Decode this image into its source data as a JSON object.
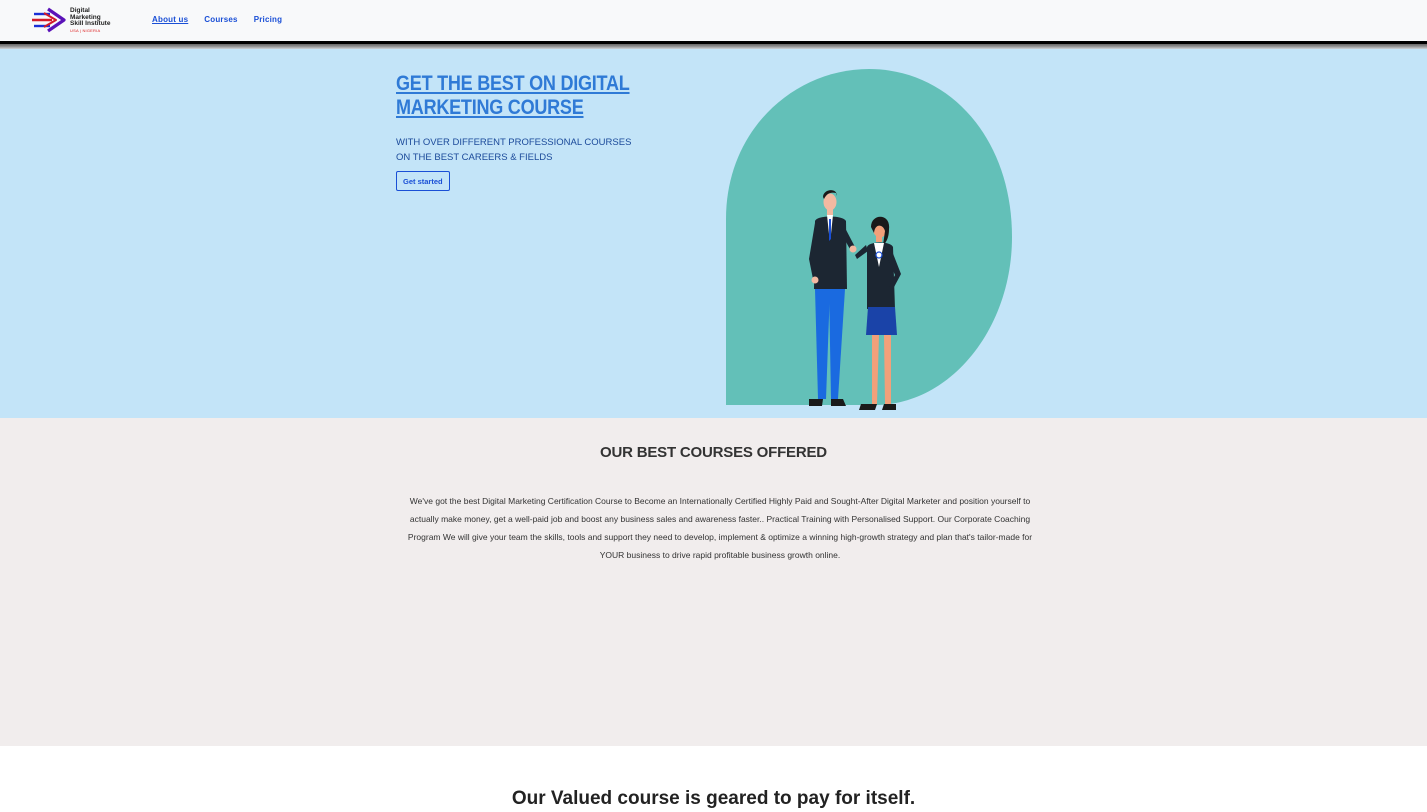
{
  "navbar": {
    "logo": {
      "lines": [
        "Digital",
        "Marketing",
        "Skill Institute"
      ],
      "sub": "USA | NIGERIA"
    },
    "links": [
      {
        "label": "About us",
        "active": true
      },
      {
        "label": "Courses",
        "active": false
      },
      {
        "label": "Pricing",
        "active": false
      }
    ]
  },
  "hero": {
    "title": "GET THE BEST ON DIGITAL MARKETING COURSE",
    "subtitle_line1": "WITH OVER DIFFERENT PROFESSIONAL COURSES",
    "subtitle_line2": "ON THE BEST CAREERS & FIELDS",
    "cta_label": "Get started",
    "illustration": "two-people-handshake-illustration"
  },
  "courses": {
    "title": "OUR BEST COURSES OFFERED",
    "text": "We've got the best Digital Marketing Certification Course to Become an Internationally Certified Highly Paid and Sought-After Digital Marketer and position yourself to actually make money, get a well-paid job and boost any business sales and awareness faster.. Practical Training with Personalised Support. Our Corporate Coaching Program We will give your team the skills, tools and support they need to develop, implement & optimize a winning high-growth strategy and plan that's tailor-made for YOUR business to drive rapid profitable business growth online."
  },
  "valued": {
    "title": "Our Valued course is geared to pay for itself."
  },
  "colors": {
    "hero_bg": "#c3e4f8",
    "accent": "#1a4fd6",
    "blob": "#63c0b8",
    "courses_bg": "#f1eded"
  }
}
